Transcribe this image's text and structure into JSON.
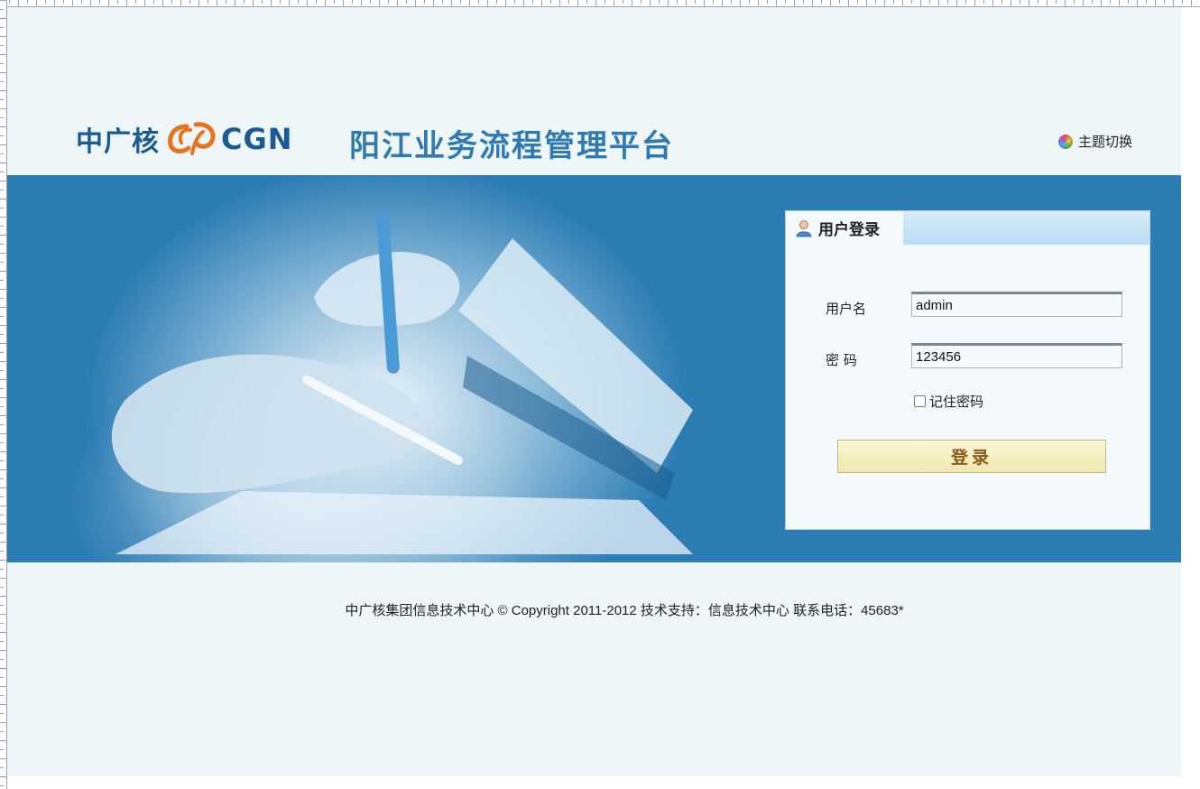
{
  "header": {
    "logo_cn": "中广核",
    "logo_en": "CGN",
    "title": "阳江业务流程管理平台",
    "theme_switch_label": "主题切换"
  },
  "login": {
    "panel_title": "用户登录",
    "username_label": "用户名",
    "username_value": "admin",
    "password_label": "密 码",
    "password_value": "123456",
    "remember_label": "记住密码",
    "submit_label": "登录"
  },
  "footer": {
    "text": "中广核集团信息技术中心 © Copyright 2011-2012 技术支持：信息技术中心 联系电话：45683*"
  },
  "colors": {
    "page_bg": "#eef6f8",
    "banner_bg": "#2d7db5",
    "title": "#2f7ab3",
    "logo": "#1c5a96",
    "logo_mark": "#e8731c",
    "button_text": "#8a5a1c"
  },
  "icons": {
    "theme": "theme-icon",
    "user": "user-icon",
    "logo_mark": "cgn-logo-mark-icon"
  }
}
